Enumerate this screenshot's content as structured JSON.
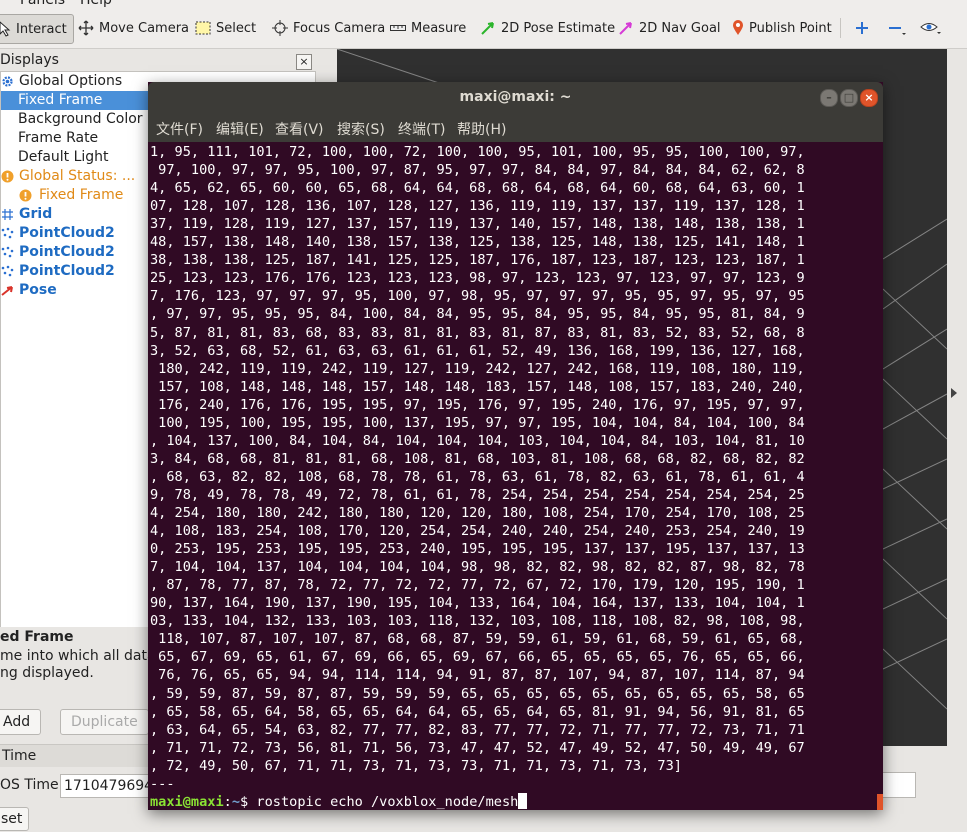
{
  "menubar": {
    "panels_label": "Panels",
    "help_label": "Help"
  },
  "toolbar": {
    "interact": "Interact",
    "move_camera": "Move Camera",
    "select": "Select",
    "focus_camera": "Focus Camera",
    "measure": "Measure",
    "pose_estimate": "2D Pose Estimate",
    "nav_goal": "2D Nav Goal",
    "publish_point": "Publish Point"
  },
  "displays": {
    "header": "Displays",
    "close": "×",
    "items": [
      {
        "label": "Global Options"
      },
      {
        "label": "Fixed Frame"
      },
      {
        "label": "Background Color"
      },
      {
        "label": "Frame Rate"
      },
      {
        "label": "Default Light"
      },
      {
        "label": "Global Status: ..."
      },
      {
        "label": "Fixed Frame"
      },
      {
        "label": "Grid"
      },
      {
        "label": "PointCloud2"
      },
      {
        "label": "PointCloud2"
      },
      {
        "label": "PointCloud2"
      },
      {
        "label": "Pose"
      }
    ],
    "description_title": "ed Frame",
    "description_lines": [
      "me into which all data",
      "ng displayed."
    ],
    "add_button": "Add",
    "duplicate_button": "Duplicate"
  },
  "time_panel": {
    "header": "Time",
    "ros_time_label": "OS Time:",
    "ros_time_value": "1710479694",
    "reset_button": "set"
  },
  "terminal": {
    "title": "maxi@maxi: ~",
    "menu": [
      "文件(F)",
      "编辑(E)",
      "查看(V)",
      "搜索(S)",
      "终端(T)",
      "帮助(H)"
    ],
    "lines": [
      "1, 95, 111, 101, 72, 100, 100, 72, 100, 100, 95, 101, 100, 95, 95, 100, 100, 97,",
      " 97, 100, 97, 97, 95, 100, 97, 87, 95, 97, 97, 84, 84, 97, 84, 84, 84, 62, 62, 8",
      "4, 65, 62, 65, 60, 60, 65, 68, 64, 64, 68, 68, 64, 68, 64, 60, 68, 64, 63, 60, 1",
      "07, 128, 107, 128, 136, 107, 128, 127, 136, 119, 119, 137, 137, 119, 137, 128, 1",
      "37, 119, 128, 119, 127, 137, 157, 119, 137, 140, 157, 148, 138, 148, 138, 138, 1",
      "48, 157, 138, 148, 140, 138, 157, 138, 125, 138, 125, 148, 138, 125, 141, 148, 1",
      "38, 138, 138, 125, 187, 141, 125, 125, 187, 176, 187, 123, 187, 123, 123, 187, 1",
      "25, 123, 123, 176, 176, 123, 123, 123, 98, 97, 123, 123, 97, 123, 97, 97, 123, 9",
      "7, 176, 123, 97, 97, 97, 95, 100, 97, 98, 95, 97, 97, 97, 95, 95, 97, 95, 97, 95",
      ", 97, 97, 95, 95, 95, 84, 100, 84, 84, 95, 95, 84, 95, 95, 84, 95, 95, 81, 84, 9",
      "5, 87, 81, 81, 83, 68, 83, 83, 81, 81, 83, 81, 87, 83, 81, 83, 52, 83, 52, 68, 8",
      "3, 52, 63, 68, 52, 61, 63, 63, 61, 61, 61, 52, 49, 136, 168, 199, 136, 127, 168,",
      " 180, 242, 119, 119, 242, 119, 127, 119, 242, 127, 242, 168, 119, 108, 180, 119,",
      " 157, 108, 148, 148, 148, 157, 148, 148, 183, 157, 148, 108, 157, 183, 240, 240,",
      " 176, 240, 176, 176, 195, 195, 97, 195, 176, 97, 195, 240, 176, 97, 195, 97, 97,",
      " 100, 195, 100, 195, 195, 100, 137, 195, 97, 97, 195, 104, 104, 84, 104, 100, 84",
      ", 104, 137, 100, 84, 104, 84, 104, 104, 104, 103, 104, 104, 84, 103, 104, 81, 10",
      "3, 84, 68, 68, 81, 81, 81, 68, 108, 81, 68, 103, 81, 108, 68, 68, 82, 68, 82, 82",
      ", 68, 63, 82, 82, 108, 68, 78, 78, 61, 78, 63, 61, 78, 82, 63, 61, 78, 61, 61, 4",
      "9, 78, 49, 78, 78, 49, 72, 78, 61, 61, 78, 254, 254, 254, 254, 254, 254, 254, 25",
      "4, 254, 180, 180, 242, 180, 180, 120, 120, 180, 108, 254, 170, 254, 170, 108, 25",
      "4, 108, 183, 254, 108, 170, 120, 254, 254, 240, 240, 254, 240, 253, 254, 240, 19",
      "0, 253, 195, 253, 195, 195, 253, 240, 195, 195, 195, 137, 137, 195, 137, 137, 13",
      "7, 104, 104, 137, 104, 104, 104, 104, 98, 98, 82, 82, 98, 82, 82, 87, 98, 82, 78",
      ", 87, 78, 77, 87, 78, 72, 77, 72, 72, 77, 72, 67, 72, 170, 179, 120, 195, 190, 1",
      "90, 137, 164, 190, 137, 190, 195, 104, 133, 164, 104, 164, 137, 133, 104, 104, 1",
      "03, 133, 104, 132, 133, 103, 103, 118, 132, 103, 108, 118, 108, 82, 98, 108, 98,",
      " 118, 107, 87, 107, 107, 87, 68, 68, 87, 59, 59, 61, 59, 61, 68, 59, 61, 65, 68,",
      " 65, 67, 69, 65, 61, 67, 69, 66, 65, 69, 67, 66, 65, 65, 65, 65, 76, 65, 65, 66,",
      " 76, 76, 65, 65, 94, 94, 114, 114, 94, 91, 87, 87, 107, 94, 87, 107, 114, 87, 94",
      ", 59, 59, 87, 59, 87, 87, 59, 59, 59, 65, 65, 65, 65, 65, 65, 65, 65, 65, 58, 65",
      ", 65, 58, 65, 64, 58, 65, 65, 64, 64, 65, 65, 64, 65, 81, 91, 94, 56, 91, 81, 65",
      ", 63, 64, 65, 54, 63, 82, 77, 77, 82, 83, 77, 77, 72, 71, 77, 77, 72, 73, 71, 71",
      ", 71, 71, 72, 73, 56, 81, 71, 56, 73, 47, 47, 52, 47, 49, 52, 47, 50, 49, 49, 67",
      ", 72, 49, 50, 67, 71, 71, 73, 71, 73, 73, 71, 71, 73, 71, 73, 73]",
      "---"
    ],
    "prompt_user": "maxi@maxi",
    "prompt_sep": ":",
    "prompt_path": "~",
    "prompt_dollar": "$ ",
    "command": "rostopic echo /voxblox_node/mesh"
  },
  "colors": {
    "terminal_bg": "#300a24",
    "prompt_green": "#8ae234",
    "prompt_blue": "#729fcf",
    "selection": "#4a90d9",
    "close_orange": "#e0542a"
  }
}
